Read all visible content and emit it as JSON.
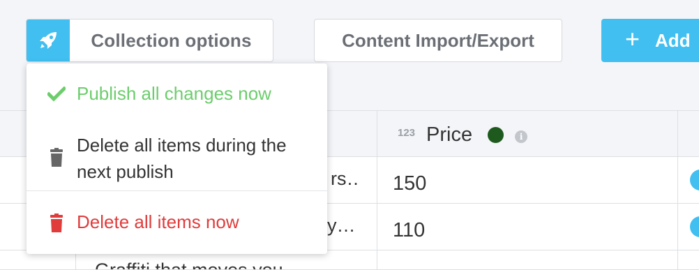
{
  "toolbar": {
    "collection_options_label": "Collection options",
    "import_export_label": "Content Import/Export",
    "add_label": "Add",
    "add_symbol": "+"
  },
  "dropdown": {
    "publish_label": "Publish all changes now",
    "delete_next_label": "Delete all items during the next publish",
    "delete_now_label": "Delete all items now"
  },
  "table": {
    "price_column": {
      "type_badge": "123",
      "title": "Price",
      "info_symbol": "i"
    },
    "rows": [
      {
        "name": "rs…",
        "price": "150"
      },
      {
        "name": "y…",
        "price": "110"
      },
      {
        "name": "Graffiti that moves you",
        "price": ""
      }
    ]
  },
  "colors": {
    "accent": "#41bff0",
    "success": "#6ccd6c",
    "danger": "#e03c3c",
    "status_dot": "#1e5a1e"
  },
  "icons": {
    "collection": "rocket-icon",
    "add": "plus-icon",
    "publish": "check-icon",
    "delete_next": "trash-icon",
    "delete_now": "trash-icon",
    "info": "info-icon"
  }
}
